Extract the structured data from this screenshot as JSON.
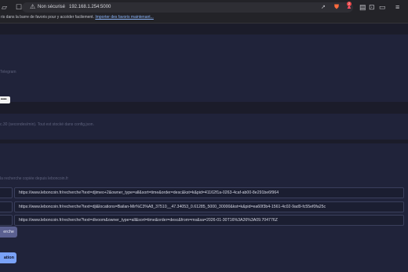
{
  "browser": {
    "security_label": "Non sécurisé",
    "address": "192.168.1.254:5000",
    "notification_count": "2"
  },
  "bookmarks": {
    "prompt": "ris dans la barre de favoris pour y accéder facilement.",
    "import_link": "Importer des favoris maintenant..."
  },
  "page": {
    "telegram_hint": "Telegram",
    "password_value": "••••••",
    "interval_hint": "c.30 (secondes/min). Tout est stocké dans config.json.",
    "search_hint": "la recherche copiée depuis leboncoin.fr",
    "searches": [
      "https://www.leboncoin.fr/recherche?text=djimeo+2&owner_type=all&sort=time&order=desc&kst=k&pid=41162f1a-0263-4caf-ab00-8e291be6f964",
      "https://www.leboncoin.fr/recherche?text=dji&locations=Bailan-Mir%C3%A8_37510__47.34053_0.61285_5000_30000&kst=k&pid=ea60f3b4-1561-4c02-9ad9-fc55ef0fa25c",
      "https://www.leboncoin.fr/recherche?text=divoom&owner_type=all&sort=time&order=desc&from=ms&sa=2026-01-30T16%3A26%3A09.704776Z"
    ],
    "search_button": "erche",
    "save_button": "ation"
  },
  "colors": {
    "accent": "#7aa2f7",
    "background": "#1b1c2a",
    "card": "#20233a"
  }
}
